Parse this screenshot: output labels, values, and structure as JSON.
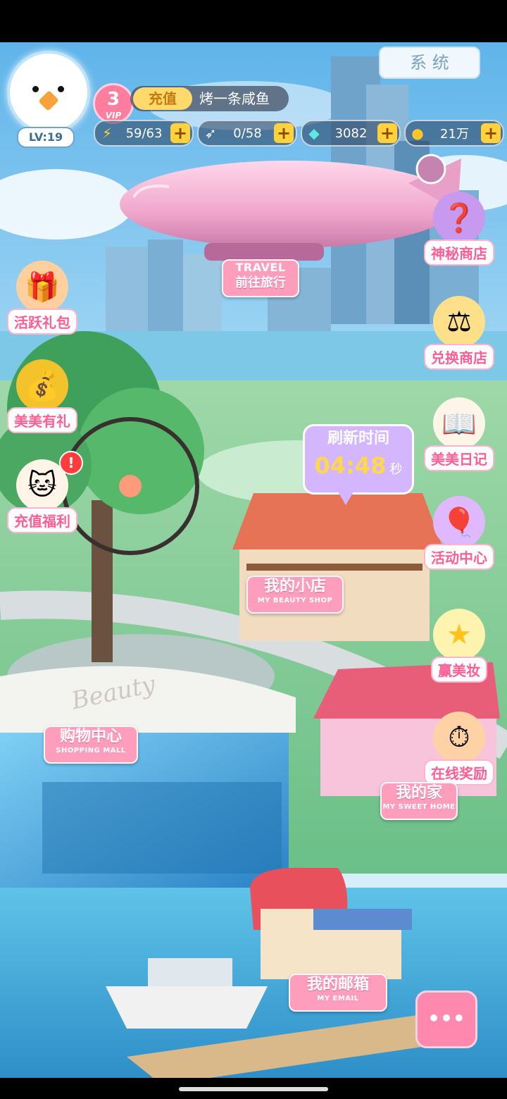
{
  "header": {
    "system_label": "系 统",
    "level": "LV:19",
    "vip_level": "3",
    "vip_tag": "VIP",
    "recharge_label": "充值",
    "player_name": "烤一条咸鱼"
  },
  "resources": [
    {
      "icon": "lightning-icon",
      "value": "59/63"
    },
    {
      "icon": "wing-icon",
      "value": "0/58"
    },
    {
      "icon": "diamond-icon",
      "value": "3082"
    },
    {
      "icon": "coin-icon",
      "value": "21万"
    }
  ],
  "left_menu": [
    {
      "label": "活跃礼包",
      "icon": "gift-box-icon"
    },
    {
      "label": "美美有礼",
      "icon": "lucky-bag-icon"
    },
    {
      "label": "充值福利",
      "icon": "lucky-cat-icon"
    }
  ],
  "right_menu": [
    {
      "label": "神秘商店",
      "icon": "mystery-box-icon"
    },
    {
      "label": "兑换商店",
      "icon": "scale-icon"
    },
    {
      "label": "美美日记",
      "icon": "diary-icon"
    },
    {
      "label": "活动中心",
      "icon": "balloons-icon"
    },
    {
      "label": "赢美妆",
      "icon": "star-icon"
    },
    {
      "label": "在线奖励",
      "icon": "timer-gift-icon"
    }
  ],
  "map_labels": {
    "travel_en": "TRAVEL",
    "travel_cn": "前往旅行",
    "shop_cn": "我的小店",
    "shop_en": "MY BEAUTY SHOP",
    "mall_cn": "购物中心",
    "mall_en": "SHOPPING MALL",
    "home_cn": "我的家",
    "home_en": "MY SWEET HOME",
    "email_cn": "我的邮箱",
    "email_en": "MY EMAIL",
    "mall_sign": "Beauty"
  },
  "refresh_bubble": {
    "title": "刷新时间",
    "time": "04:48",
    "unit": "秒"
  },
  "more_button": "•••",
  "colors": {
    "accent_pink": "#ff9dbd",
    "label_text_pink": "#ff5d94",
    "sky": "#8cc8f0",
    "water": "#3aa8d8",
    "timer_yellow": "#ffd84a"
  }
}
